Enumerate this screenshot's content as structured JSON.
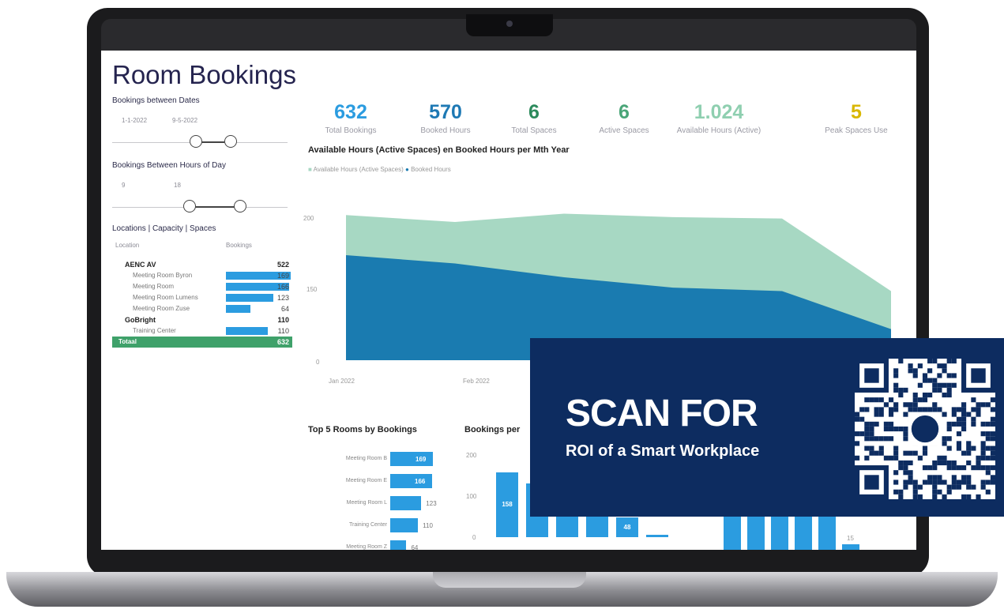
{
  "dashboard": {
    "title": "Room Bookings",
    "filters": {
      "dates": {
        "label": "Bookings between Dates",
        "start": "1-1-2022",
        "end": "9-5-2022"
      },
      "hours": {
        "label": "Bookings Between Hours of Day",
        "start": "9",
        "end": "18"
      }
    },
    "table": {
      "title": "Locations | Capacity | Spaces",
      "columns": [
        "Location",
        "Bookings"
      ],
      "rows": [
        {
          "name": "AENC AV",
          "value": "522",
          "type": "group",
          "fill": 0
        },
        {
          "name": "Meeting Room Byron",
          "value": "169",
          "type": "item",
          "fill": 1.0
        },
        {
          "name": "Meeting Room",
          "value": "166",
          "type": "item",
          "fill": 0.98
        },
        {
          "name": "Meeting Room Lumens",
          "value": "123",
          "type": "item",
          "fill": 0.73
        },
        {
          "name": "Meeting Room Zuse",
          "value": "64",
          "type": "item",
          "fill": 0.38
        },
        {
          "name": "GoBright",
          "value": "110",
          "type": "group",
          "fill": 0
        },
        {
          "name": "Training Center",
          "value": "110",
          "type": "item",
          "fill": 0.65
        },
        {
          "name": "Totaal",
          "value": "632",
          "type": "total",
          "fill": 0
        }
      ]
    },
    "kpis": [
      {
        "value": "632",
        "label": "Total Bookings",
        "color": "#2b9ce0"
      },
      {
        "value": "570",
        "label": "Booked Hours",
        "color": "#1e79b4"
      },
      {
        "value": "6",
        "label": "Total Spaces",
        "color": "#2c8a5c"
      },
      {
        "value": "6",
        "label": "Active Spaces",
        "color": "#4aa578"
      },
      {
        "value": "1.024",
        "label": "Available Hours (Active)",
        "color": "#8fcfb0"
      },
      {
        "value": "5",
        "label": "Peak Spaces Use",
        "color": "#d9b700"
      }
    ],
    "area_chart": {
      "title": "Available Hours (Active Spaces) en Booked Hours per Mth Year",
      "legend": [
        "Available Hours (Active Spaces)",
        "Booked Hours"
      ],
      "y_ticks": [
        "200",
        "150",
        "0"
      ],
      "x_ticks": [
        "Jan 2022",
        "Feb 2022"
      ],
      "available": [
        210,
        200,
        212,
        207,
        205,
        100
      ],
      "booked": [
        152,
        140,
        120,
        105,
        100,
        45
      ],
      "colors": {
        "available": "#a7d8c3",
        "booked": "#1a7bb0"
      }
    },
    "top5": {
      "title": "Top 5 Rooms by Bookings",
      "rooms": [
        {
          "name": "Meeting Room B",
          "value": 169,
          "shown": "169"
        },
        {
          "name": "Meeting Room E",
          "value": 166,
          "shown": "166"
        },
        {
          "name": "Meeting Room L",
          "value": 123,
          "shown": "123"
        },
        {
          "name": "Training Center",
          "value": 110,
          "shown": "110"
        },
        {
          "name": "Meeting Room Z",
          "value": 64,
          "shown": "64"
        }
      ]
    },
    "bookings_per": {
      "title": "Bookings per",
      "y_ticks": [
        "200",
        "100",
        "0"
      ],
      "values": [
        158,
        130,
        100,
        95,
        48,
        5
      ],
      "shown": [
        "158",
        "",
        "",
        "",
        "48",
        ""
      ]
    },
    "right_bars": {
      "values": [
        120,
        120,
        118,
        115,
        100,
        15
      ],
      "shown": [
        "",
        "",
        "",
        "",
        "",
        "15"
      ]
    }
  },
  "promo": {
    "headline": "SCAN FOR",
    "subline": "ROI of a Smart Workplace"
  }
}
